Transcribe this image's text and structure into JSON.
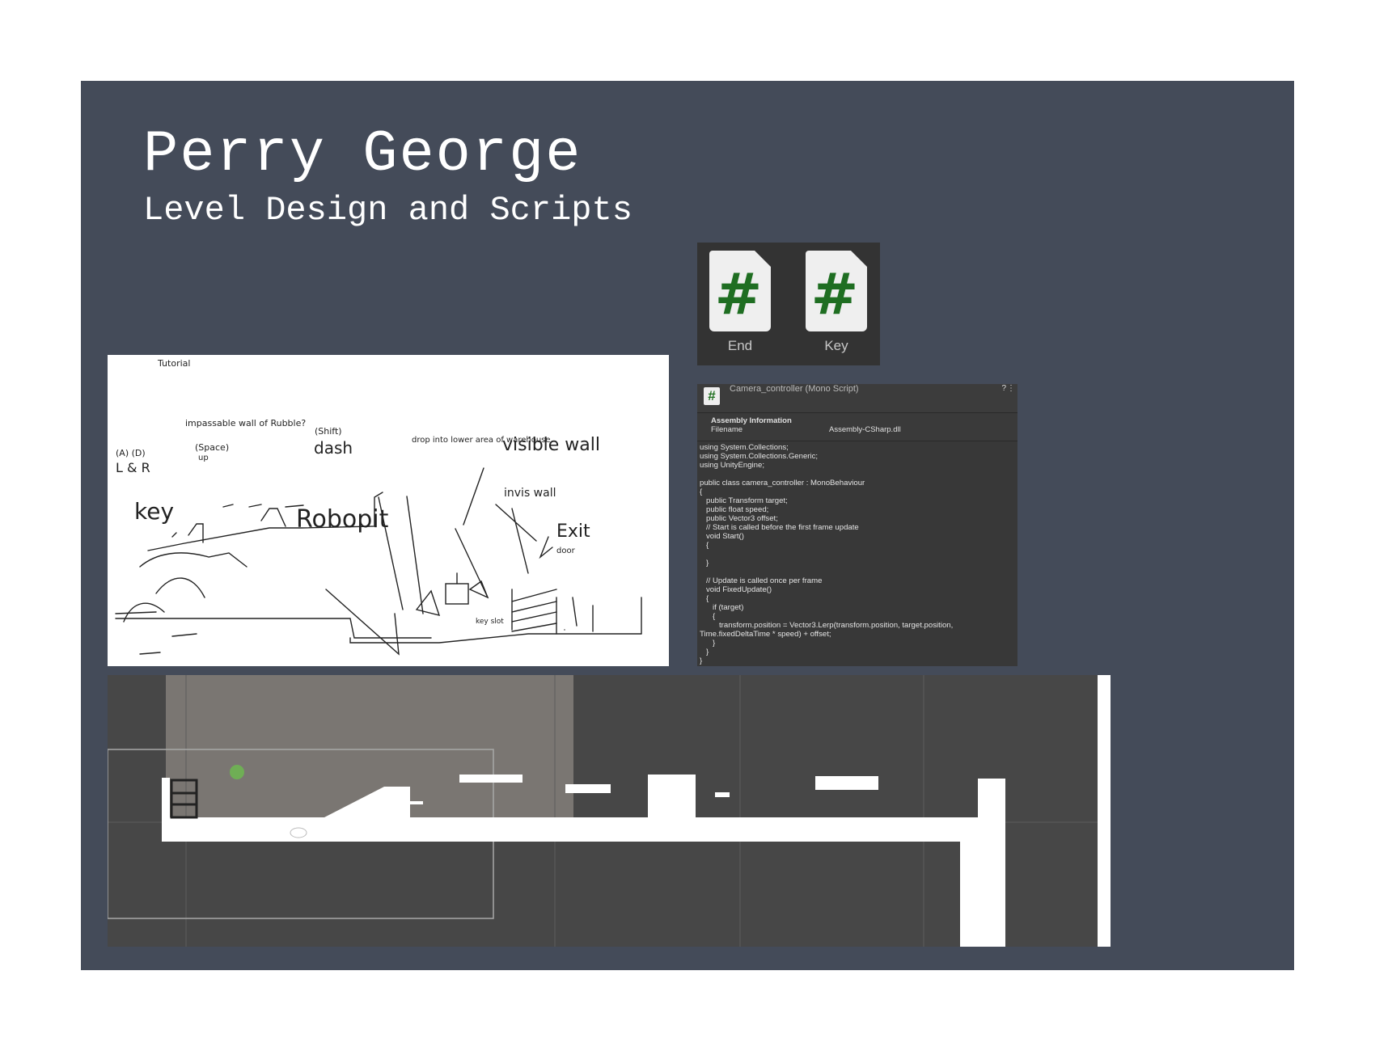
{
  "slide": {
    "title": "Perry George",
    "subtitle": "Level Design and Scripts",
    "background_color": "#444b59"
  },
  "script_icons": [
    {
      "label": "End",
      "icon": "csharp-script-icon"
    },
    {
      "label": "Key",
      "icon": "csharp-script-icon"
    }
  ],
  "inspector": {
    "title": "Camera_controller (Mono Script)",
    "help_icon": "?",
    "menu_icon": "⋮",
    "assembly_header": "Assembly Information",
    "filename_label": "Filename",
    "filename_value": "Assembly-CSharp.dll",
    "code": "using System.Collections;\nusing System.Collections.Generic;\nusing UnityEngine;\n\npublic class camera_controller : MonoBehaviour\n{\n   public Transform target;\n   public float speed;\n   public Vector3 offset;\n   // Start is called before the first frame update\n   void Start()\n   {\n\n   }\n\n   // Update is called once per frame\n   void FixedUpdate()\n   {\n      if (target)\n      {\n         transform.position = Vector3.Lerp(transform.position, target.position,\nTime.fixedDeltaTime * speed) + offset;\n      }\n   }\n}"
  },
  "sketch": {
    "labels": {
      "tutorial": "Tutorial",
      "impassable": "impassable wall of Rubble?",
      "shift": "(Shift)",
      "dash": "dash",
      "a_d": "(A) (D)",
      "lr": "L & R",
      "space": "(Space)",
      "up": "up",
      "key": "key",
      "robopit": "Robopit",
      "drop": "drop into lower area of warehouse",
      "visible_wall": "visible wall",
      "invis_wall": "invis wall",
      "exit": "Exit",
      "door": "door",
      "key_slot": "key slot"
    }
  },
  "scene": {
    "background_color": "#474747",
    "level_color": "#ffffff"
  }
}
